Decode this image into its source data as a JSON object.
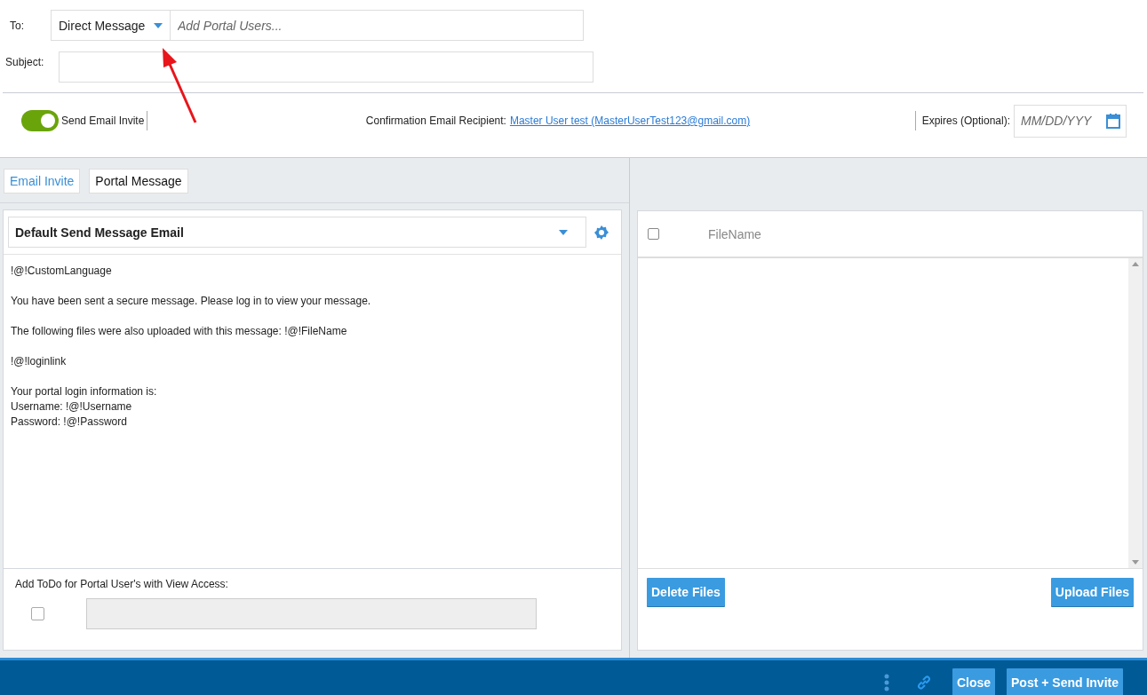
{
  "to": {
    "label": "To:",
    "type_dropdown": {
      "value": "Direct Message"
    },
    "recipients": {
      "placeholder": "Add Portal Users..."
    }
  },
  "subject": {
    "label": "Subject:"
  },
  "send_email_invite": {
    "label": "Send Email Invite",
    "on": true
  },
  "confirmation": {
    "label": "Confirmation Email Recipient:",
    "link": "Master User test (MasterUserTest123@gmail.com)"
  },
  "expires": {
    "label": "Expires (Optional):",
    "placeholder": "MM/DD/YYY"
  },
  "tabs": [
    {
      "label": "Email Invite",
      "selected": true
    },
    {
      "label": "Portal Message",
      "selected": false
    }
  ],
  "template": {
    "value": "Default Send Message Email"
  },
  "body_paragraphs": [
    [
      "!@!CustomLanguage"
    ],
    [
      "You have been sent a secure message. Please log in to view your message."
    ],
    [
      "The following files were also uploaded with this message: !@!FileName"
    ],
    [
      "!@!loginlink"
    ],
    [
      "Your portal login information is:",
      "Username: !@!Username",
      "Password: !@!Password"
    ]
  ],
  "todo": {
    "label": "Add ToDo for Portal User's with View Access:",
    "checked": false
  },
  "files": {
    "select_all": false,
    "columns": [
      "FileName"
    ]
  },
  "file_buttons": [
    "Delete Files",
    "Upload Files"
  ],
  "footer_buttons": [
    "Close",
    "Post + Send Invite"
  ]
}
